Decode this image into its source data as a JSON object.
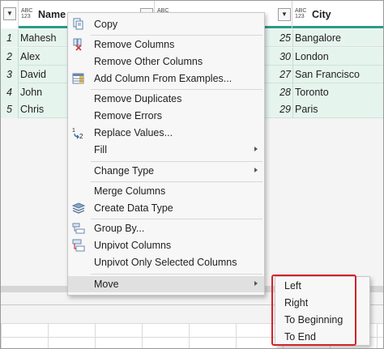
{
  "columns": [
    {
      "type_icon": "ABC\n123",
      "title": "Name"
    },
    {
      "type_icon": "ABC\n123",
      "title": ""
    },
    {
      "type_icon": "ABC\n123",
      "title": ""
    },
    {
      "type_icon": "ABC\n123",
      "title": "City"
    }
  ],
  "rows": [
    {
      "index": "1",
      "name": "Mahesh",
      "age": "25",
      "city": "Bangalore"
    },
    {
      "index": "2",
      "name": "Alex",
      "age": "30",
      "city": "London"
    },
    {
      "index": "3",
      "name": "David",
      "age": "27",
      "city": "San Francisco"
    },
    {
      "index": "4",
      "name": "John",
      "age": "28",
      "city": "Toronto"
    },
    {
      "index": "5",
      "name": "Chris",
      "age": "29",
      "city": "Paris"
    }
  ],
  "context_menu": {
    "copy": "Copy",
    "remove_columns": "Remove Columns",
    "remove_other_columns": "Remove Other Columns",
    "add_column_from_examples": "Add Column From Examples...",
    "remove_duplicates": "Remove Duplicates",
    "remove_errors": "Remove Errors",
    "replace_values": "Replace Values...",
    "fill": "Fill",
    "change_type": "Change Type",
    "merge_columns": "Merge Columns",
    "create_data_type": "Create Data Type",
    "group_by": "Group By...",
    "unpivot_columns": "Unpivot Columns",
    "unpivot_only_selected": "Unpivot Only Selected Columns",
    "move": "Move"
  },
  "move_submenu": {
    "left": "Left",
    "right": "Right",
    "to_beginning": "To Beginning",
    "to_end": "To End"
  },
  "colors": {
    "accent": "#2a9b88",
    "selected_row": "#e6f4ee",
    "highlight_box": "#d2232a"
  }
}
